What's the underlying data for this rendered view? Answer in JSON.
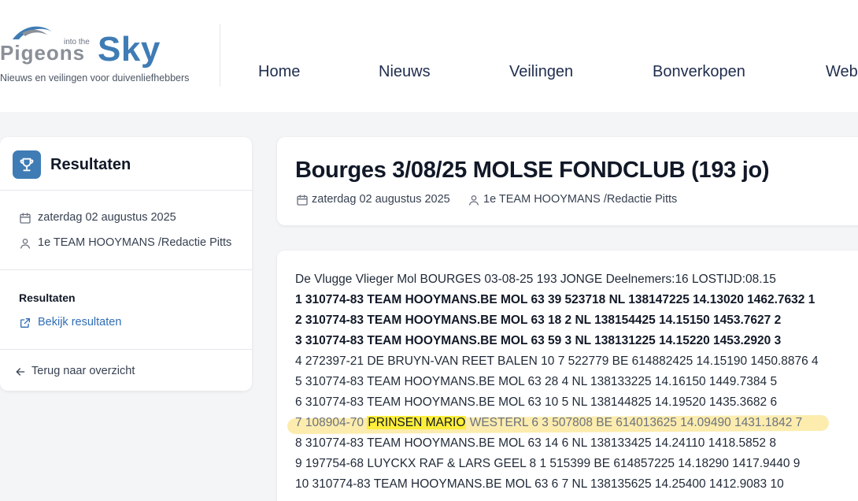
{
  "site": {
    "logo_word_1": "Pigeons",
    "logo_into": "into the",
    "logo_word_2": "Sky",
    "tagline": "Nieuws en veilingen voor duivenliefhebbers",
    "brand_color": "#3f7cb5"
  },
  "nav": {
    "items": [
      {
        "label": "Home"
      },
      {
        "label": "Nieuws"
      },
      {
        "label": "Veilingen"
      },
      {
        "label": "Bonverkopen"
      },
      {
        "label": "Web"
      }
    ]
  },
  "sidebar": {
    "title": "Resultaten",
    "icon": "trophy-icon",
    "date": "zaterdag 02 augustus 2025",
    "author": "1e TEAM HOOYMANS /Redactie Pitts",
    "results_heading": "Resultaten",
    "results_link": "Bekijk resultaten",
    "back_link": "Terug naar overzicht"
  },
  "article": {
    "title": "Bourges 3/08/25 MOLSE FONDCLUB (193 jo)",
    "date": "zaterdag 02 augustus 2025",
    "author": "1e TEAM HOOYMANS /Redactie Pitts"
  },
  "results": {
    "header_line": "De Vlugge Vlieger Mol BOURGES 03-08-25 193 JONGE Deelnemers:16 LOSTIJD:08.15",
    "lines": [
      "1 310774-83 TEAM HOOYMANS.BE MOL 63 39 523718 NL 138147225 14.13020 1462.7632 1",
      "2 310774-83 TEAM HOOYMANS.BE MOL 63 18 2 NL 138154425 14.15150 1453.7627 2",
      "3 310774-83 TEAM HOOYMANS.BE MOL 63 59 3 NL 138131225 14.15220 1453.2920 3",
      "4 272397-21 DE BRUYN-VAN REET BALEN 10 7 522779 BE 614882425 14.15190 1450.8876 4",
      "5 310774-83 TEAM HOOYMANS.BE MOL 63 28 4 NL 138133225 14.16150 1449.7384 5",
      "6 310774-83 TEAM HOOYMANS.BE MOL 63 10 5 NL 138144825 14.19520 1435.3682 6",
      "8 310774-83 TEAM HOOYMANS.BE MOL 63 14 6 NL 138133425 14.24110 1418.5852 8",
      "9 197754-68 LUYCKX RAF & LARS GEEL 8 1 515399 BE 614857225 14.18290 1417.9440 9",
      "10 310774-83 TEAM HOOYMANS.BE MOL 63 6 7 NL 138135625 14.25400 1412.9083 10"
    ],
    "highlight": {
      "prefix": "7 108904-70",
      "name": "PRINSEN MARIO",
      "suffix": "WESTERL 6 3 507808 BE 614013625 14.09490 1431.1842 7"
    },
    "highlight_color": "#fbe9a0",
    "marker_color": "#ffef3a"
  }
}
